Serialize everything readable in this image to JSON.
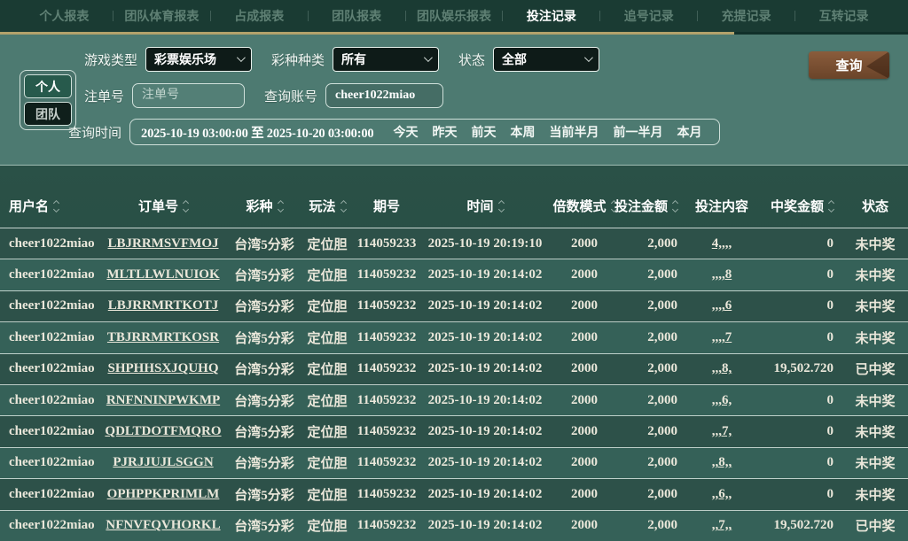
{
  "nav": {
    "items": [
      {
        "label": "个人报表",
        "active": false
      },
      {
        "label": "团队体育报表",
        "active": false
      },
      {
        "label": "占成报表",
        "active": false
      },
      {
        "label": "团队报表",
        "active": false
      },
      {
        "label": "团队娱乐报表",
        "active": false
      },
      {
        "label": "投注记录",
        "active": true
      },
      {
        "label": "追号记录",
        "active": false
      },
      {
        "label": "充提记录",
        "active": false
      },
      {
        "label": "互转记录",
        "active": false
      }
    ]
  },
  "filters": {
    "scope_personal": "个人",
    "scope_team": "团队",
    "game_type_label": "游戏类型",
    "game_type_value": "彩票娱乐场",
    "lottery_kind_label": "彩种种类",
    "lottery_kind_value": "所有",
    "status_label": "状态",
    "status_value": "全部",
    "query_button": "查询",
    "order_no_label": "注单号",
    "order_no_placeholder": "注单号",
    "account_label": "查询账号",
    "account_value": "cheer1022miao",
    "time_label": "查询时间",
    "time_value": "2025-10-19 03:00:00 至 2025-10-20 03:00:00",
    "quick_ranges": [
      "今天",
      "昨天",
      "前天",
      "本周",
      "当前半月",
      "前一半月",
      "本月"
    ]
  },
  "table": {
    "columns": [
      {
        "label": "用户名",
        "sort": true,
        "align": "left",
        "width": 110
      },
      {
        "label": "订单号",
        "sort": true,
        "align": "center",
        "width": 148
      },
      {
        "label": "彩种",
        "sort": true,
        "align": "center",
        "width": 80
      },
      {
        "label": "玩法",
        "sort": true,
        "align": "center",
        "width": 62
      },
      {
        "label": "期号",
        "sort": false,
        "align": "center",
        "width": 72
      },
      {
        "label": "时间",
        "sort": true,
        "align": "center",
        "width": 150
      },
      {
        "label": "倍数模式",
        "sort": true,
        "align": "center",
        "width": 74
      },
      {
        "label": "投注金额",
        "sort": true,
        "align": "right",
        "width": 78
      },
      {
        "label": "投注内容",
        "sort": false,
        "align": "center",
        "width": 80
      },
      {
        "label": "中奖金额",
        "sort": true,
        "align": "right",
        "width": 96
      },
      {
        "label": "状态",
        "sort": false,
        "align": "center",
        "width": 74
      }
    ],
    "rows": [
      [
        "cheer1022miao",
        "LBJRRMSVFMOJ",
        "台湾5分彩",
        "定位胆",
        "114059233",
        "2025-10-19 20:19:10",
        "2000",
        "2,000",
        "4,,,,",
        "0",
        "未中奖"
      ],
      [
        "cheer1022miao",
        "MLTLLWLNUIOK",
        "台湾5分彩",
        "定位胆",
        "114059232",
        "2025-10-19 20:14:02",
        "2000",
        "2,000",
        ",,,,8",
        "0",
        "未中奖"
      ],
      [
        "cheer1022miao",
        "LBJRRMRTKOTJ",
        "台湾5分彩",
        "定位胆",
        "114059232",
        "2025-10-19 20:14:02",
        "2000",
        "2,000",
        ",,,,6",
        "0",
        "未中奖"
      ],
      [
        "cheer1022miao",
        "TBJRRMRTKOSR",
        "台湾5分彩",
        "定位胆",
        "114059232",
        "2025-10-19 20:14:02",
        "2000",
        "2,000",
        ",,,,7",
        "0",
        "未中奖"
      ],
      [
        "cheer1022miao",
        "SHPHHSXJQUHQ",
        "台湾5分彩",
        "定位胆",
        "114059232",
        "2025-10-19 20:14:02",
        "2000",
        "2,000",
        ",,,8,",
        "19,502.720",
        "已中奖"
      ],
      [
        "cheer1022miao",
        "RNFNNINPWKMP",
        "台湾5分彩",
        "定位胆",
        "114059232",
        "2025-10-19 20:14:02",
        "2000",
        "2,000",
        ",,,6,",
        "0",
        "未中奖"
      ],
      [
        "cheer1022miao",
        "QDLTDOTFMQRO",
        "台湾5分彩",
        "定位胆",
        "114059232",
        "2025-10-19 20:14:02",
        "2000",
        "2,000",
        ",,,7,",
        "0",
        "未中奖"
      ],
      [
        "cheer1022miao",
        "PJRJJUJLSGGN",
        "台湾5分彩",
        "定位胆",
        "114059232",
        "2025-10-19 20:14:02",
        "2000",
        "2,000",
        ",,8,,",
        "0",
        "未中奖"
      ],
      [
        "cheer1022miao",
        "OPHPPKPRIMLM",
        "台湾5分彩",
        "定位胆",
        "114059232",
        "2025-10-19 20:14:02",
        "2000",
        "2,000",
        ",,6,,",
        "0",
        "未中奖"
      ],
      [
        "cheer1022miao",
        "NFNVFQVHORKL",
        "台湾5分彩",
        "定位胆",
        "114059232",
        "2025-10-19 20:14:02",
        "2000",
        "2,000",
        ",,7,,",
        "19,502.720",
        "已中奖"
      ]
    ],
    "link_columns": [
      1,
      8
    ]
  },
  "colors": {
    "nav_bg": "#1a3b33",
    "nav_active_text": "#ffffff",
    "nav_inactive_text": "#5f8074",
    "gold_underline": "#b3a26b",
    "filter_bg": "#4d7a71",
    "select_bg": "#0e1b18",
    "query_button": "#7a4f32",
    "table_bg_odd": "#2d5149",
    "table_bg_even": "#356158",
    "table_text": "#eae7da"
  }
}
